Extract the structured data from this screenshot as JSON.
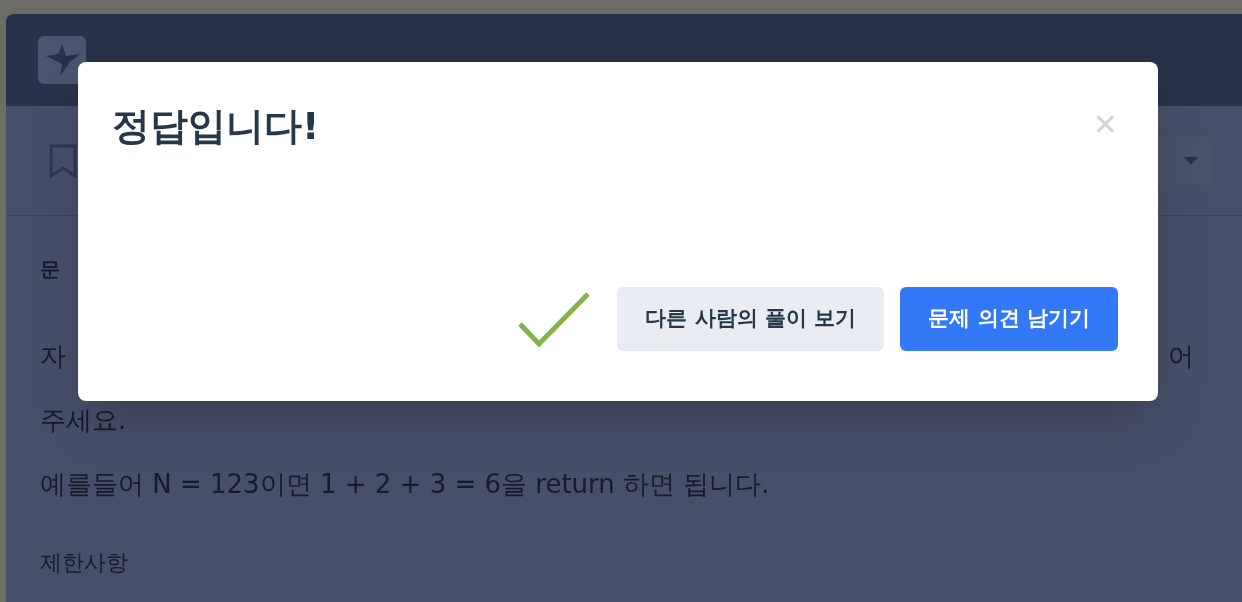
{
  "page": {
    "section_label": "문",
    "description_lines": [
      {
        "left": "자",
        "right": "어"
      },
      {
        "left": "주세요."
      },
      {
        "left": "예를들어 N = 123이면 1 + 2 + 3 = 6을 return 하면 됩니다."
      }
    ],
    "constraints_label": "제한사항"
  },
  "dialog": {
    "title": "정답입니다!",
    "close": "✕",
    "buttons": [
      {
        "label": "다른 사람의 풀이 보기",
        "kind": "secondary"
      },
      {
        "label": "문제 의견 남기기",
        "kind": "primary"
      }
    ]
  }
}
